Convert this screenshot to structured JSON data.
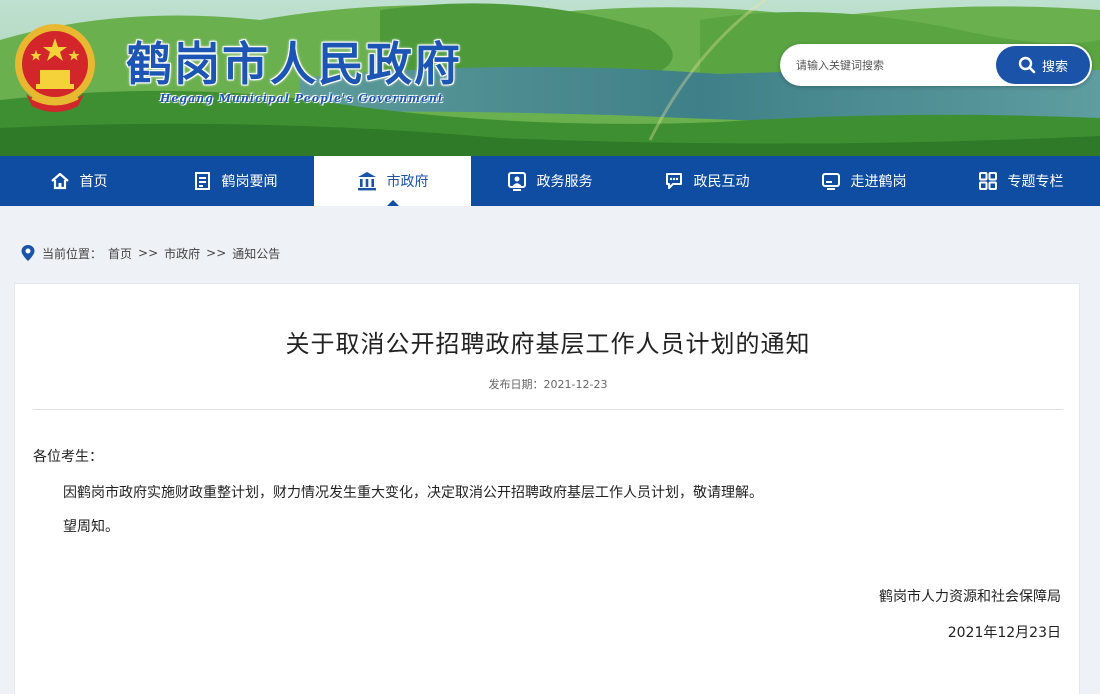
{
  "header": {
    "site_title": "鹤岗市人民政府",
    "site_subtitle": "Hegang Municipal People's Government",
    "search": {
      "placeholder": "请输入关键词搜索",
      "button_label": "搜索"
    }
  },
  "nav": {
    "items": [
      {
        "label": "首页",
        "icon": "home-icon"
      },
      {
        "label": "鹤岗要闻",
        "icon": "news-icon"
      },
      {
        "label": "市政府",
        "icon": "government-building-icon"
      },
      {
        "label": "政务服务",
        "icon": "service-icon"
      },
      {
        "label": "政民互动",
        "icon": "chat-icon"
      },
      {
        "label": "走进鹤岗",
        "icon": "monitor-icon"
      },
      {
        "label": "专题专栏",
        "icon": "grid-icon"
      }
    ],
    "active_index": 2
  },
  "breadcrumb": {
    "prefix": "当前位置：",
    "items": [
      "首页",
      "市政府",
      "通知公告"
    ],
    "separator": ">>"
  },
  "article": {
    "title": "关于取消公开招聘政府基层工作人员计划的通知",
    "publish_date_label": "发布日期：",
    "publish_date": "2021-12-23",
    "salutation": "各位考生：",
    "paragraphs": [
      "因鹤岗市政府实施财政重整计划，财力情况发生重大变化，决定取消公开招聘政府基层工作人员计划，敬请理解。",
      "望周知。"
    ],
    "signature": "鹤岗市人力资源和社会保障局",
    "sign_date": "2021年12月23日"
  },
  "colors": {
    "nav_blue": "#0f4da3",
    "title_blue": "#1d55b4",
    "button_blue": "#1b53a8"
  }
}
